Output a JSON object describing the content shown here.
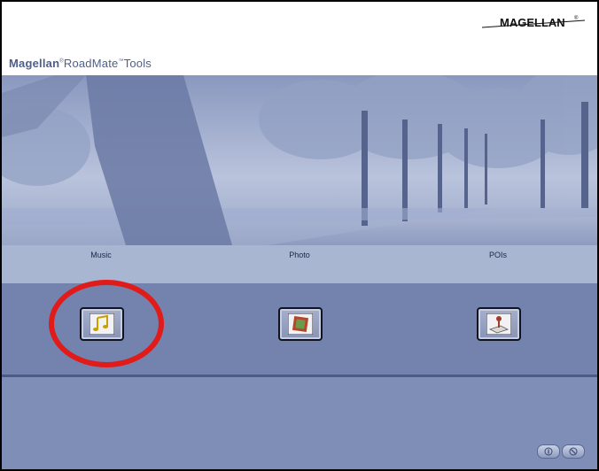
{
  "header": {
    "app_brand": "Magellan",
    "app_reg": "®",
    "app_name": "RoadMate",
    "app_tm": "™",
    "app_suffix": "Tools",
    "logo_text": "MAGELLAN",
    "logo_mark": "®"
  },
  "categories": [
    {
      "label": "Music",
      "icon": "music-notes-icon"
    },
    {
      "label": "Photo",
      "icon": "photo-frame-icon"
    },
    {
      "label": "POIs",
      "icon": "map-pin-icon"
    }
  ],
  "footer": {
    "buttons": [
      "help-icon",
      "close-icon"
    ]
  },
  "colors": {
    "accent_blue": "#4d5f8a",
    "label_strip": "#a9b6d2",
    "icon_band": "#7383ad",
    "footer": "#7f8eb7",
    "highlight": "#e11a1a"
  }
}
